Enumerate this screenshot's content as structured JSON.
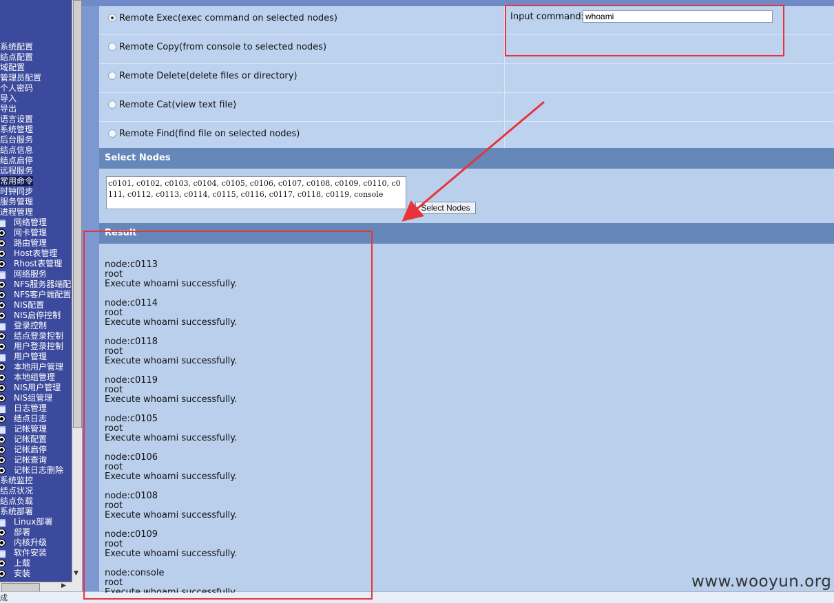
{
  "sidebar": {
    "items": [
      {
        "label": "系统配置",
        "level": 1,
        "icon": ""
      },
      {
        "label": "结点配置",
        "level": 1,
        "icon": ""
      },
      {
        "label": "域配置",
        "level": 1,
        "icon": ""
      },
      {
        "label": "管理员配置",
        "level": 1,
        "icon": ""
      },
      {
        "label": "个人密码",
        "level": 1,
        "icon": ""
      },
      {
        "label": "导入",
        "level": 1,
        "icon": ""
      },
      {
        "label": "导出",
        "level": 1,
        "icon": ""
      },
      {
        "label": "语言设置",
        "level": 1,
        "icon": ""
      },
      {
        "label": "系统管理",
        "level": 1,
        "icon": ""
      },
      {
        "label": "后台服务",
        "level": 1,
        "icon": ""
      },
      {
        "label": "结点信息",
        "level": 1,
        "icon": ""
      },
      {
        "label": "结点启停",
        "level": 1,
        "icon": ""
      },
      {
        "label": "远程服务",
        "level": 1,
        "icon": ""
      },
      {
        "label": "常用命令",
        "level": 1,
        "icon": "",
        "selected": true
      },
      {
        "label": "时钟同步",
        "level": 1,
        "icon": ""
      },
      {
        "label": "服务管理",
        "level": 1,
        "icon": ""
      },
      {
        "label": "进程管理",
        "level": 1,
        "icon": ""
      },
      {
        "label": "网络管理",
        "level": 2,
        "icon": "folder-icon"
      },
      {
        "label": "网卡管理",
        "level": 2,
        "icon": "bullet-icon"
      },
      {
        "label": "路由管理",
        "level": 2,
        "icon": "bullet-icon"
      },
      {
        "label": "Host表管理",
        "level": 2,
        "icon": "bullet-icon"
      },
      {
        "label": "Rhost表管理",
        "level": 2,
        "icon": "bullet-icon"
      },
      {
        "label": "网络服务",
        "level": 2,
        "icon": "folder-icon"
      },
      {
        "label": "NFS服务器端配置",
        "level": 2,
        "icon": "bullet-icon"
      },
      {
        "label": "NFS客户端配置",
        "level": 2,
        "icon": "bullet-icon"
      },
      {
        "label": "NIS配置",
        "level": 2,
        "icon": "bullet-icon"
      },
      {
        "label": "NIS启停控制",
        "level": 2,
        "icon": "bullet-icon"
      },
      {
        "label": "登录控制",
        "level": 2,
        "icon": "folder-icon"
      },
      {
        "label": "结点登录控制",
        "level": 2,
        "icon": "bullet-icon"
      },
      {
        "label": "用户登录控制",
        "level": 2,
        "icon": "bullet-icon"
      },
      {
        "label": "用户管理",
        "level": 2,
        "icon": "folder-icon"
      },
      {
        "label": "本地用户管理",
        "level": 2,
        "icon": "bullet-icon"
      },
      {
        "label": "本地组管理",
        "level": 2,
        "icon": "bullet-icon"
      },
      {
        "label": "NIS用户管理",
        "level": 2,
        "icon": "bullet-icon"
      },
      {
        "label": "NIS组管理",
        "level": 2,
        "icon": "bullet-icon"
      },
      {
        "label": "日志管理",
        "level": 2,
        "icon": "folder-icon"
      },
      {
        "label": "结点日志",
        "level": 2,
        "icon": "bullet-icon"
      },
      {
        "label": "记帐管理",
        "level": 2,
        "icon": "folder-icon"
      },
      {
        "label": "记帐配置",
        "level": 2,
        "icon": "bullet-icon"
      },
      {
        "label": "记帐启停",
        "level": 2,
        "icon": "bullet-icon"
      },
      {
        "label": "记帐查询",
        "level": 2,
        "icon": "bullet-icon"
      },
      {
        "label": "记帐日志删除",
        "level": 2,
        "icon": "bullet-icon"
      },
      {
        "label": "系统监控",
        "level": 1,
        "icon": ""
      },
      {
        "label": "结点状况",
        "level": 1,
        "icon": ""
      },
      {
        "label": "结点负载",
        "level": 1,
        "icon": ""
      },
      {
        "label": "系统部署",
        "level": 1,
        "icon": ""
      },
      {
        "label": "Linux部署",
        "level": 2,
        "icon": "folder-icon"
      },
      {
        "label": "部署",
        "level": 2,
        "icon": "bullet-icon"
      },
      {
        "label": "内核升级",
        "level": 2,
        "icon": "bullet-icon"
      },
      {
        "label": "软件安装",
        "level": 2,
        "icon": "folder-icon"
      },
      {
        "label": "上载",
        "level": 2,
        "icon": "bullet-icon"
      },
      {
        "label": "安装",
        "level": 2,
        "icon": "bullet-icon"
      }
    ]
  },
  "status_bar": {
    "text": "成"
  },
  "options": [
    {
      "label": "Remote Exec(exec command on selected nodes)",
      "checked": true
    },
    {
      "label": "Remote Copy(from console to selected nodes)",
      "checked": false
    },
    {
      "label": "Remote Delete(delete files or directory)",
      "checked": false
    },
    {
      "label": "Remote Cat(view text file)",
      "checked": false
    },
    {
      "label": "Remote Find(find file on selected nodes)",
      "checked": false
    }
  ],
  "command": {
    "label": "Input command:",
    "value": "whoami"
  },
  "select_nodes": {
    "header": "Select Nodes",
    "nodes_text": "c0101, c0102, c0103, c0104, c0105, c0106, c0107, c0108, c0109, c0110, c0111, c0112, c0113, c0114, c0115, c0116, c0117, c0118, c0119, console",
    "button_label": "Select Nodes"
  },
  "result": {
    "header": "Result",
    "entries": [
      {
        "node": "node:c0113",
        "output": "root",
        "status": "Execute whoami successfully."
      },
      {
        "node": "node:c0114",
        "output": "root",
        "status": "Execute whoami successfully."
      },
      {
        "node": "node:c0118",
        "output": "root",
        "status": "Execute whoami successfully."
      },
      {
        "node": "node:c0119",
        "output": "root",
        "status": "Execute whoami successfully."
      },
      {
        "node": "node:c0105",
        "output": "root",
        "status": "Execute whoami successfully."
      },
      {
        "node": "node:c0106",
        "output": "root",
        "status": "Execute whoami successfully."
      },
      {
        "node": "node:c0108",
        "output": "root",
        "status": "Execute whoami successfully."
      },
      {
        "node": "node:c0109",
        "output": "root",
        "status": "Execute whoami successfully."
      },
      {
        "node": "node:console",
        "output": "root",
        "status": "Execute whoami successfully."
      }
    ]
  },
  "watermark": "www.wooyun.org",
  "colors": {
    "annotation": "#e8333b",
    "section_header": "#6687b9",
    "sidebar": "#3b4a9c"
  }
}
